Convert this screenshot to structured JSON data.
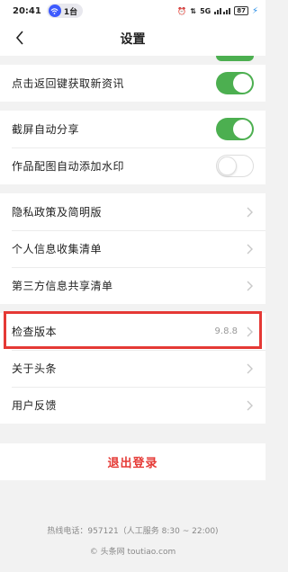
{
  "status_bar": {
    "time": "20:41",
    "chip_icon": "wifi-hotspot-icon",
    "chip_label": "1台",
    "signal_text": "5G",
    "battery": "87"
  },
  "nav": {
    "title": "设置",
    "back_icon": "chevron-left-icon"
  },
  "group1": {
    "items": [
      {
        "label": "点击返回键获取新资讯",
        "toggle": true
      }
    ]
  },
  "group2": {
    "items": [
      {
        "label": "截屏自动分享",
        "toggle": true
      },
      {
        "label": "作品配图自动添加水印",
        "toggle": false
      }
    ]
  },
  "group3": {
    "items": [
      {
        "label": "隐私政策及简明版"
      },
      {
        "label": "个人信息收集清单"
      },
      {
        "label": "第三方信息共享清单"
      }
    ]
  },
  "group4": {
    "items": [
      {
        "label": "检查版本",
        "value": "9.8.8"
      },
      {
        "label": "关于头条"
      },
      {
        "label": "用户反馈"
      }
    ]
  },
  "logout": {
    "label": "退出登录"
  },
  "footer": {
    "hotline": "热线电话：957121（人工服务 8:30 ~ 22:00)",
    "copyright": "© 头条网 toutiao.com"
  },
  "colors": {
    "toggle_on": "#4caf50",
    "logout_red": "#e53935",
    "highlight_red": "#e53935"
  }
}
